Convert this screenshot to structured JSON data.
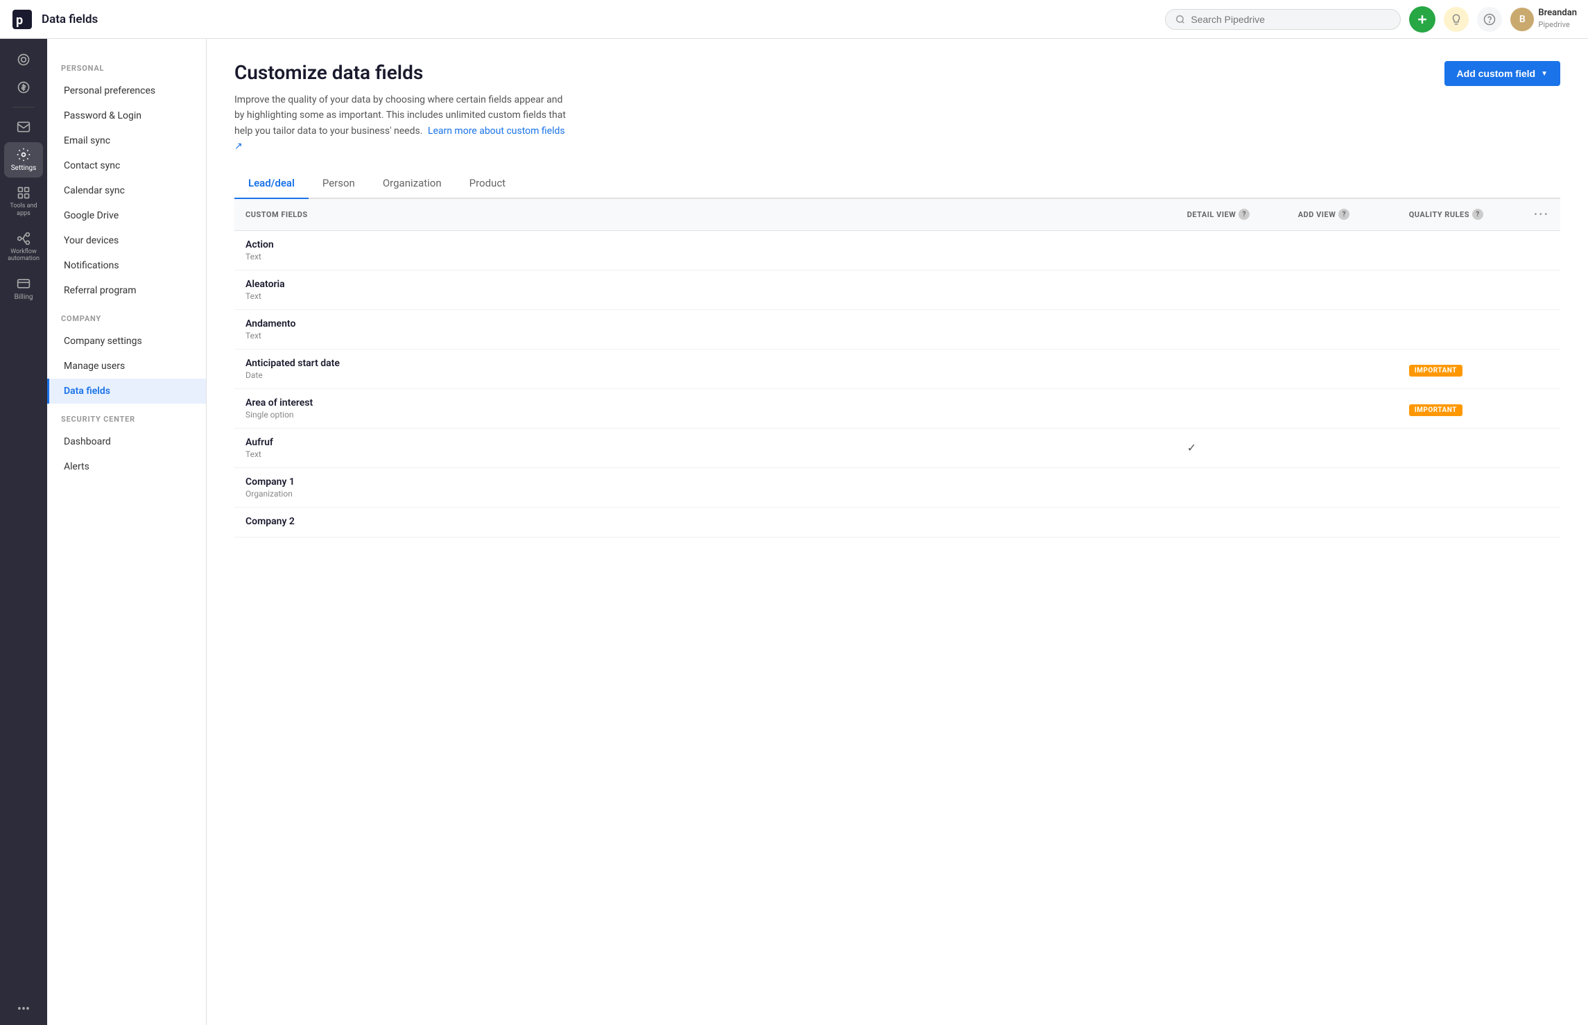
{
  "topbar": {
    "page_title": "Data fields",
    "search_placeholder": "Search Pipedrive",
    "add_btn_label": "+",
    "lightbulb_icon": "💡",
    "help_icon": "?",
    "user": {
      "name": "Breandan",
      "company": "Pipedrive",
      "avatar_initials": "B"
    }
  },
  "sidebar": {
    "items": [
      {
        "id": "dashboard",
        "label": "",
        "icon": "circle"
      },
      {
        "id": "deals",
        "label": "",
        "icon": "dollar"
      },
      {
        "id": "divider1",
        "label": ""
      },
      {
        "id": "email",
        "label": "",
        "icon": "mail"
      },
      {
        "id": "calendar",
        "label": "",
        "icon": "calendar"
      },
      {
        "id": "reports",
        "label": "",
        "icon": "bar-chart"
      },
      {
        "id": "trends",
        "label": "",
        "icon": "trend"
      },
      {
        "id": "inbox",
        "label": "",
        "icon": "inbox"
      }
    ],
    "more_label": "•••"
  },
  "settings_nav": {
    "personal_section_label": "PERSONAL",
    "personal_items": [
      {
        "id": "personal-preferences",
        "label": "Personal preferences"
      },
      {
        "id": "password-login",
        "label": "Password & Login"
      },
      {
        "id": "email-sync",
        "label": "Email sync"
      },
      {
        "id": "contact-sync",
        "label": "Contact sync"
      },
      {
        "id": "calendar-sync",
        "label": "Calendar sync"
      },
      {
        "id": "google-drive",
        "label": "Google Drive"
      },
      {
        "id": "your-devices",
        "label": "Your devices"
      },
      {
        "id": "notifications",
        "label": "Notifications"
      },
      {
        "id": "referral-program",
        "label": "Referral program"
      }
    ],
    "company_section_label": "COMPANY",
    "company_items": [
      {
        "id": "company-settings",
        "label": "Company settings"
      },
      {
        "id": "manage-users",
        "label": "Manage users"
      },
      {
        "id": "data-fields",
        "label": "Data fields",
        "active": true
      }
    ],
    "security_section_label": "SECURITY CENTER",
    "security_items": [
      {
        "id": "dashboard",
        "label": "Dashboard"
      },
      {
        "id": "alerts",
        "label": "Alerts"
      }
    ]
  },
  "left_nav": {
    "settings_label": "Settings",
    "tools_label": "Tools and apps",
    "workflow_label": "Workflow automation",
    "billing_label": "Billing"
  },
  "main": {
    "title": "Customize data fields",
    "description": "Improve the quality of your data by choosing where certain fields appear and by highlighting some as important. This includes unlimited custom fields that help you tailor data to your business' needs.",
    "learn_more_text": "Learn more about custom fields ↗",
    "add_custom_field_label": "Add custom field",
    "tabs": [
      {
        "id": "lead-deal",
        "label": "Lead/deal",
        "active": true
      },
      {
        "id": "person",
        "label": "Person"
      },
      {
        "id": "organization",
        "label": "Organization"
      },
      {
        "id": "product",
        "label": "Product"
      }
    ],
    "table": {
      "columns": [
        {
          "id": "custom-fields",
          "label": "CUSTOM FIELDS"
        },
        {
          "id": "detail-view",
          "label": "DETAIL VIEW",
          "has_help": true
        },
        {
          "id": "add-view",
          "label": "ADD VIEW",
          "has_help": true
        },
        {
          "id": "quality-rules",
          "label": "QUALITY RULES",
          "has_help": true
        },
        {
          "id": "more",
          "label": "···"
        }
      ],
      "rows": [
        {
          "id": "action",
          "name": "Action",
          "type": "Text",
          "detail_view": "",
          "add_view": "",
          "quality_rules": "",
          "badge": ""
        },
        {
          "id": "aleatoria",
          "name": "Aleatoria",
          "type": "Text",
          "detail_view": "",
          "add_view": "",
          "quality_rules": "",
          "badge": ""
        },
        {
          "id": "andamento",
          "name": "Andamento",
          "type": "Text",
          "detail_view": "",
          "add_view": "",
          "quality_rules": "",
          "badge": ""
        },
        {
          "id": "anticipated-start-date",
          "name": "Anticipated start date",
          "type": "Date",
          "detail_view": "",
          "add_view": "",
          "quality_rules": "",
          "badge": "IMPORTANT"
        },
        {
          "id": "area-of-interest",
          "name": "Area of interest",
          "type": "Single option",
          "detail_view": "",
          "add_view": "",
          "quality_rules": "",
          "badge": "IMPORTANT"
        },
        {
          "id": "aufruf",
          "name": "Aufruf",
          "type": "Text",
          "detail_view": "✓",
          "add_view": "",
          "quality_rules": "",
          "badge": ""
        },
        {
          "id": "company-1",
          "name": "Company 1",
          "type": "Organization",
          "detail_view": "",
          "add_view": "",
          "quality_rules": "",
          "badge": ""
        },
        {
          "id": "company-2",
          "name": "Company 2",
          "type": "",
          "detail_view": "",
          "add_view": "",
          "quality_rules": "",
          "badge": ""
        }
      ]
    }
  }
}
